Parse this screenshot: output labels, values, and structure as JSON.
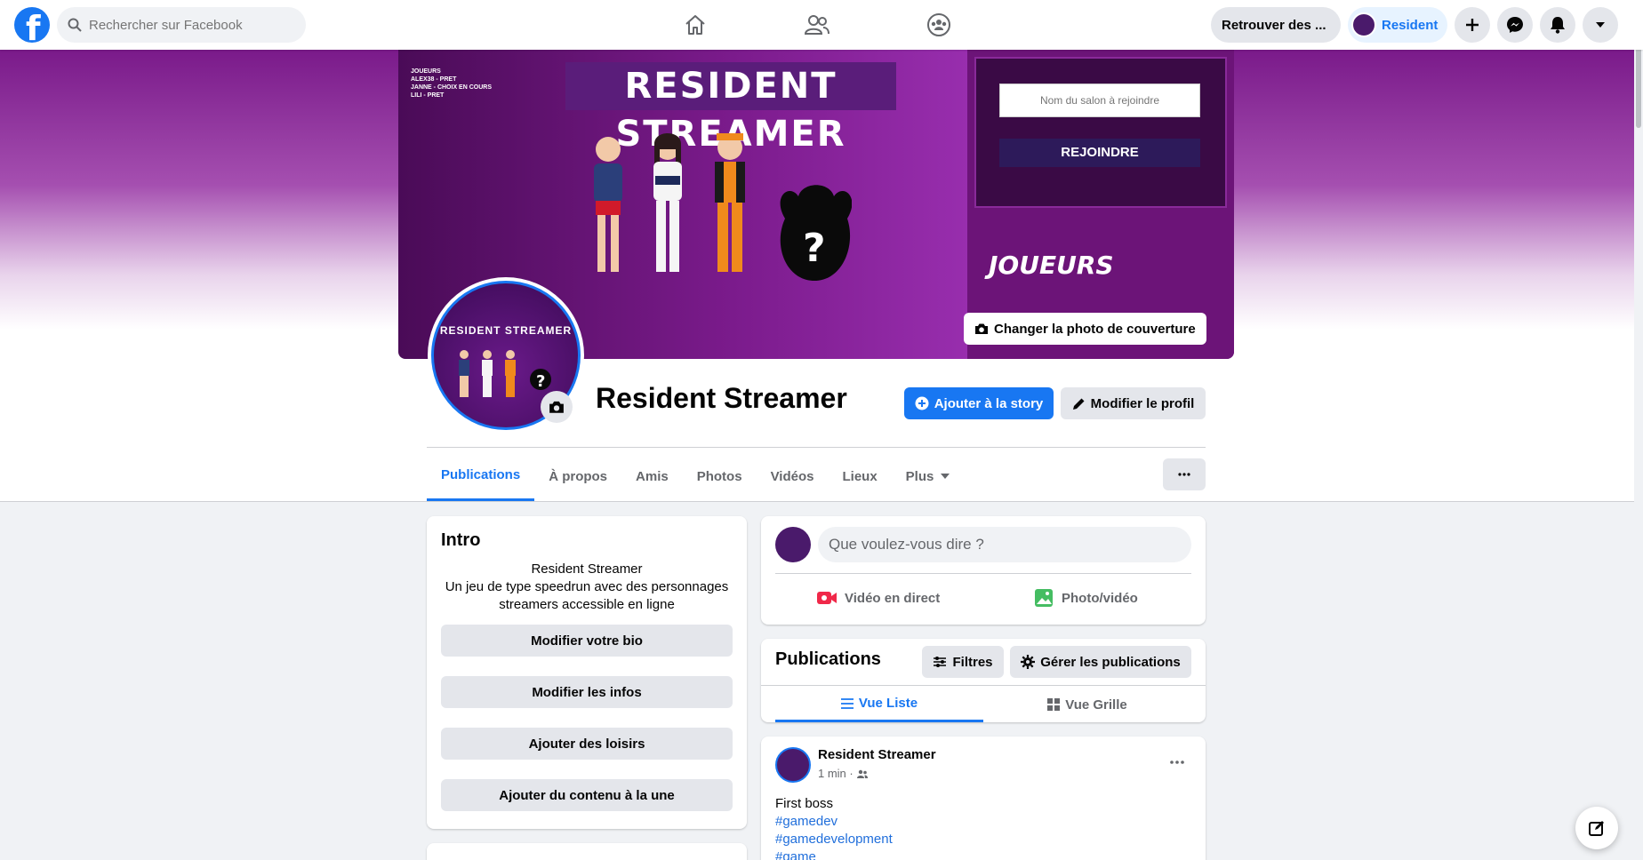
{
  "topbar": {
    "search_placeholder": "Rechercher sur Facebook",
    "find_friends": "Retrouver des ...",
    "profile_name": "Resident"
  },
  "cover": {
    "title": "RESIDENT STREAMER",
    "small_title": "JOUEURS",
    "small_lines": [
      "ALEX38 - PRET",
      "JANNE - CHOIX EN COURS",
      "LILI - PRET"
    ],
    "room_placeholder": "Nom du salon à rejoindre",
    "join_label": "REJOINDRE",
    "players_label": "JOUEURS",
    "change_cover_label": "Changer la photo de couverture"
  },
  "profile": {
    "name": "Resident Streamer",
    "avatar_text": "RESIDENT STREAMER",
    "add_story_label": "Ajouter à la story",
    "edit_profile_label": "Modifier le profil"
  },
  "tabs": [
    {
      "label": "Publications",
      "active": true
    },
    {
      "label": "À propos"
    },
    {
      "label": "Amis"
    },
    {
      "label": "Photos"
    },
    {
      "label": "Vidéos"
    },
    {
      "label": "Lieux"
    },
    {
      "label": "Plus"
    }
  ],
  "intro": {
    "title": "Intro",
    "bio_line1": "Resident Streamer",
    "bio_line2": "Un jeu de type speedrun avec des personnages streamers accessible en ligne",
    "buttons": [
      "Modifier votre bio",
      "Modifier les infos",
      "Ajouter des loisirs",
      "Ajouter du contenu à la une"
    ]
  },
  "composer": {
    "placeholder": "Que voulez-vous dire ?",
    "live_label": "Vidéo en direct",
    "photo_label": "Photo/vidéo"
  },
  "publications": {
    "title": "Publications",
    "filters_label": "Filtres",
    "manage_label": "Gérer les publications",
    "list_view_label": "Vue Liste",
    "grid_view_label": "Vue Grille"
  },
  "post": {
    "author": "Resident Streamer",
    "time": "1 min ·",
    "text": "First boss",
    "hashtags": [
      "#gamedev",
      "#gamedevelopment",
      "#game"
    ]
  },
  "colors": {
    "brand": "#1877f2",
    "cover_purple": "#7b1b8c"
  }
}
